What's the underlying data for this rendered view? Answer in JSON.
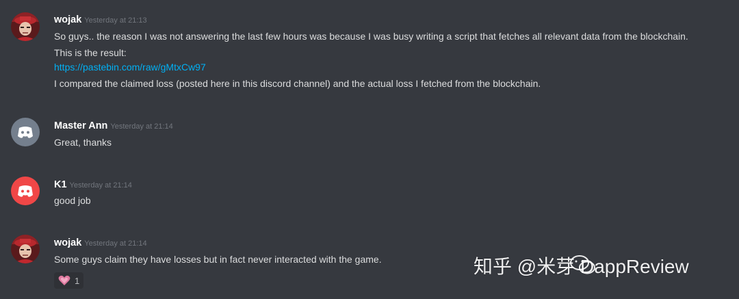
{
  "messages": [
    {
      "username": "wojak",
      "timestamp": "Yesterday at 21:13",
      "avatar_icon": "wojak-avatar",
      "lines": [
        "So guys.. the reason I was not answering the last few hours was because I was busy writing a script that fetches all relevant data from the blockchain.",
        "This is the result:",
        "https://pastebin.com/raw/gMtxCw97",
        "I compared the claimed loss (posted here in this discord channel) and the actual loss I fetched from the blockchain."
      ]
    },
    {
      "username": "Master Ann",
      "timestamp": "Yesterday at 21:14",
      "avatar_icon": "discord-default-avatar",
      "avatar_color": "#747f8d",
      "lines": [
        "Great, thanks"
      ]
    },
    {
      "username": "K1",
      "timestamp": "Yesterday at 21:14",
      "avatar_icon": "discord-default-avatar",
      "avatar_color": "#f04747",
      "lines": [
        "good job"
      ]
    },
    {
      "username": "wojak",
      "timestamp": "Yesterday at 21:14",
      "avatar_icon": "wojak-avatar",
      "lines": [
        "Some guys claim they have losses but in fact never interacted with the game."
      ],
      "reaction": {
        "icon": "pink-heart-emoji",
        "count": "1"
      }
    }
  ],
  "watermark": {
    "text": "知乎 @米芽 DappReview",
    "icon": "wechat-icon"
  },
  "colors": {
    "background": "#36393f",
    "link": "#00b0f4",
    "username": "#ffffff",
    "timestamp": "#72767d"
  }
}
